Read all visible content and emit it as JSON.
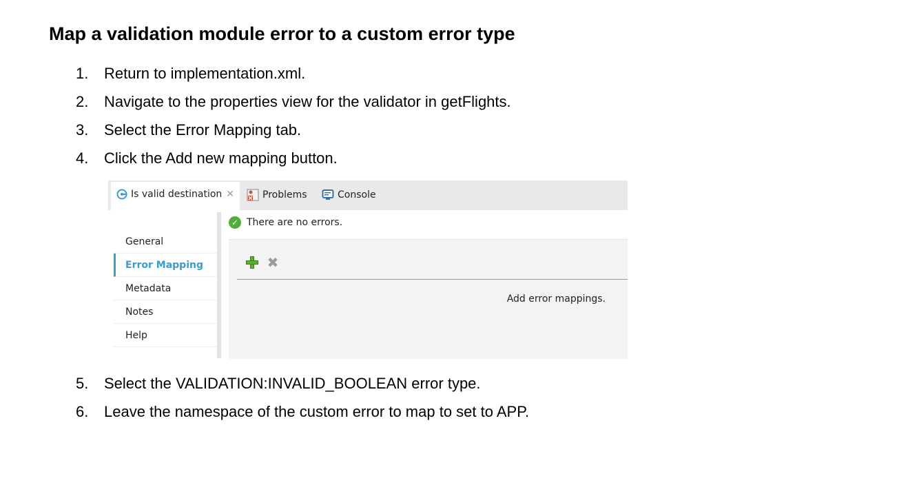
{
  "heading": "Map a validation module error to a custom error type",
  "steps_before": [
    {
      "num": "1.",
      "text": "Return to implementation.xml."
    },
    {
      "num": "2.",
      "text": "Navigate to the properties view for the validator in getFlights."
    },
    {
      "num": "3.",
      "text": "Select the Error Mapping tab."
    },
    {
      "num": "4.",
      "text": "Click the Add new mapping button."
    }
  ],
  "steps_after": [
    {
      "num": "5.",
      "text": "Select the VALIDATION:INVALID_BOOLEAN error type."
    },
    {
      "num": "6.",
      "text": "Leave the namespace of the custom error to map to set to APP."
    }
  ],
  "screenshot": {
    "tabs": [
      {
        "label": "Is valid destination",
        "icon": "validation-icon",
        "active": true
      },
      {
        "label": "Problems",
        "icon": "problems-icon",
        "active": false
      },
      {
        "label": "Console",
        "icon": "console-icon",
        "active": false
      }
    ],
    "close_glyph": "✕",
    "status_text": "There are no errors.",
    "sidebar": [
      {
        "label": "General",
        "active": false
      },
      {
        "label": "Error Mapping",
        "active": true
      },
      {
        "label": "Metadata",
        "active": false
      },
      {
        "label": "Notes",
        "active": false
      },
      {
        "label": "Help",
        "active": false
      }
    ],
    "toolbar_icons": [
      "add-mapping-icon",
      "remove-mapping-icon"
    ],
    "empty_message": "Add error mappings.",
    "colors": {
      "accent": "#3b9bd3",
      "success": "#4caf3a",
      "add": "#5bb02c"
    }
  }
}
